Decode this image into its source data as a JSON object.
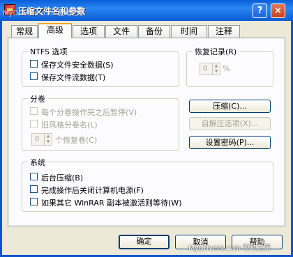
{
  "window": {
    "title": "压缩文件名和参数",
    "help_glyph": "?",
    "close_glyph": "×"
  },
  "watermark_top": "MyDrivers.com 驱动之家",
  "watermark_bottom": "MyDrivers.com 驱动之家",
  "tabs": [
    {
      "label": "常规",
      "active": false
    },
    {
      "label": "高级",
      "active": true
    },
    {
      "label": "选项",
      "active": false
    },
    {
      "label": "文件",
      "active": false
    },
    {
      "label": "备份",
      "active": false
    },
    {
      "label": "时间",
      "active": false
    },
    {
      "label": "注释",
      "active": false
    }
  ],
  "ntfs": {
    "title": "NTFS 选项",
    "save_security": "保存文件安全数据(S)",
    "save_streams": "保存文件流数据(T)"
  },
  "recovery": {
    "title": "恢复记录(R)",
    "value": "0",
    "unit": "%"
  },
  "volumes": {
    "title": "分卷",
    "pause": "每个分卷操作完之后暂停(V)",
    "old_style": "旧风格分卷名(L)",
    "recovery_value": "0",
    "recovery_label": "个恢复卷(C)"
  },
  "buttons": {
    "compression": "压缩(C)...",
    "sfx_options": "自解压选项(X)...",
    "set_password": "设置密码(P)...",
    "ok": "确定",
    "cancel": "取消",
    "help": "帮助"
  },
  "system": {
    "title": "系统",
    "background": "后台压缩(B)",
    "shutdown": "完成操作后关闭计算机电源(F)",
    "wait": "如果其它 WinRAR 副本被激活则等待(W)"
  },
  "colors": {
    "titlebar": "#0a5fd8",
    "dialog_bg": "#ece9d8",
    "tab_highlight": "#f5a523"
  }
}
